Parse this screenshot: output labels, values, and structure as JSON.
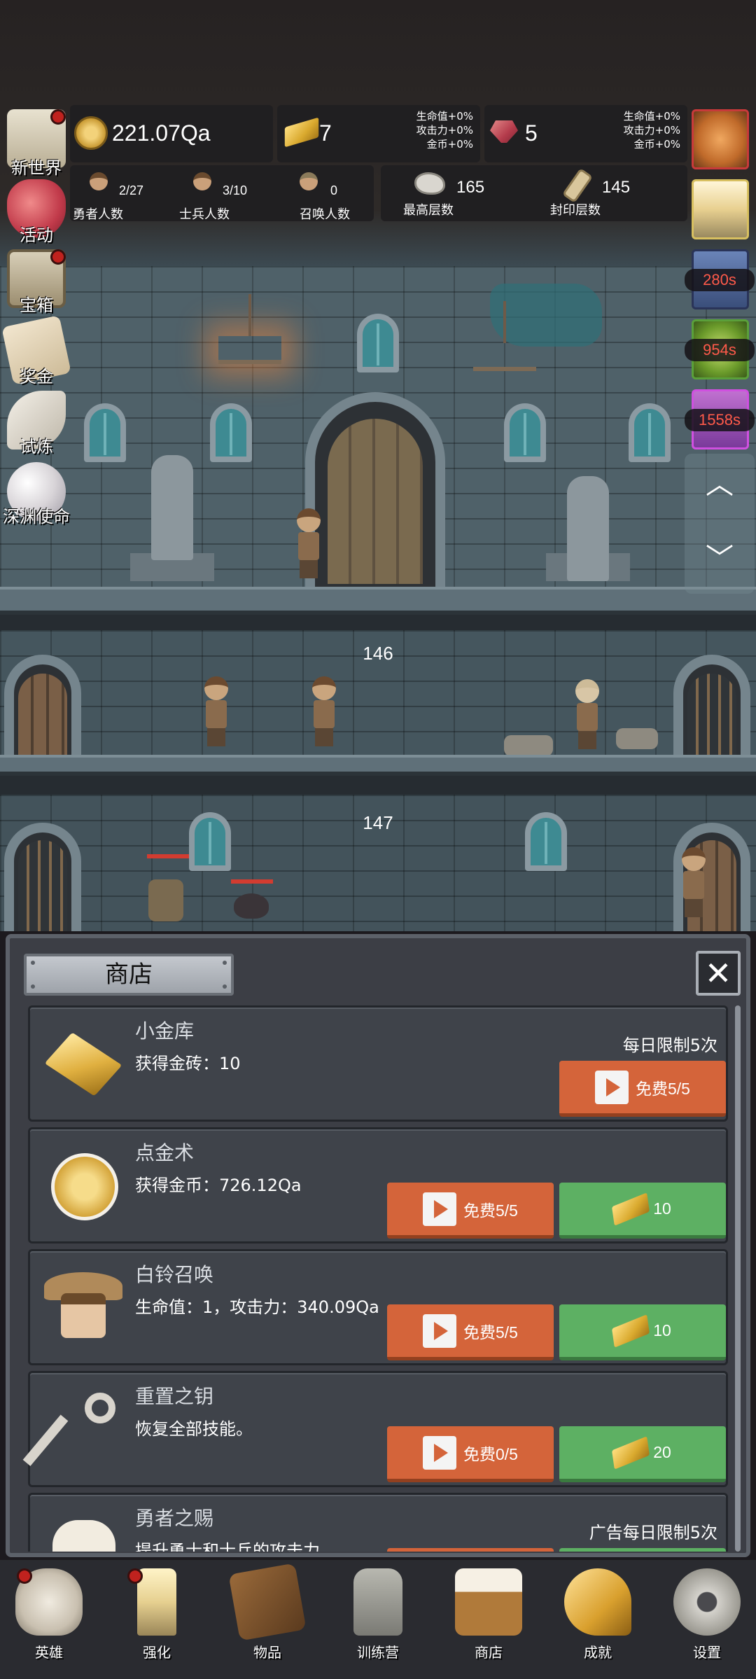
{
  "resources": {
    "gold": "221.07Qa",
    "gold_bars": "7",
    "bar_bonus": [
      "生命值+0%",
      "攻击力+0%",
      "金币+0%"
    ],
    "gems": "5",
    "gem_bonus": [
      "生命值+0%",
      "攻击力+0%",
      "金币+0%"
    ]
  },
  "counts": {
    "heroes": {
      "value": "2/27",
      "label": "勇者人数"
    },
    "soldiers": {
      "value": "3/10",
      "label": "士兵人数"
    },
    "summons": {
      "value": "0",
      "label": "召唤人数"
    },
    "max_floor": {
      "value": "165",
      "label": "最高层数"
    },
    "sealed_floor": {
      "value": "145",
      "label": "封印层数"
    }
  },
  "side_menu": [
    {
      "label": "新世界",
      "icon": "castle-icon"
    },
    {
      "label": "活动",
      "icon": "heart-icon"
    },
    {
      "label": "宝箱",
      "icon": "treasure-chest-icon"
    },
    {
      "label": "奖金",
      "icon": "envelope-icon"
    },
    {
      "label": "试炼",
      "icon": "feather-icon"
    },
    {
      "label": "深渊使命",
      "icon": "pearl-icon"
    }
  ],
  "buffs": [
    {
      "icon": "pumpkin-icon",
      "timer": ""
    },
    {
      "icon": "candle-icon",
      "timer": ""
    },
    {
      "icon": "blue-buff-icon",
      "timer": "280s"
    },
    {
      "icon": "green-buff-icon",
      "timer": "954s"
    },
    {
      "icon": "purple-buff-icon",
      "timer": "1558s"
    }
  ],
  "floors": [
    "146",
    "147"
  ],
  "shop": {
    "title": "商店",
    "close": "✕",
    "items": [
      {
        "name": "小金库",
        "desc": "获得金砖：10",
        "limit": "每日限制5次",
        "free": "免费5/5",
        "price": "",
        "icon": "gold-bar-icon"
      },
      {
        "name": "点金术",
        "desc": "获得金币：726.12Qa",
        "limit": "",
        "free": "免费5/5",
        "price": "10",
        "icon": "gold-coin-icon"
      },
      {
        "name": "白铃召唤",
        "desc": "生命值：1，攻击力：340.09Qa",
        "limit": "",
        "free": "免费5/5",
        "price": "10",
        "icon": "girl-portrait-icon"
      },
      {
        "name": "重置之钥",
        "desc": "恢复全部技能。",
        "limit": "",
        "free": "免费0/5",
        "price": "20",
        "icon": "key-icon"
      },
      {
        "name": "勇者之赐",
        "desc": "提升勇士和士兵的攻击力。",
        "limit": "广告每日限制5次",
        "free": "",
        "price": "",
        "icon": "beer-mug-icon"
      }
    ]
  },
  "nav": [
    {
      "label": "英雄",
      "icon": "skull-icon",
      "dot": true
    },
    {
      "label": "强化",
      "icon": "candle-icon",
      "dot": true
    },
    {
      "label": "物品",
      "icon": "book-icon",
      "dot": false
    },
    {
      "label": "训练营",
      "icon": "lantern-icon",
      "dot": false
    },
    {
      "label": "商店",
      "icon": "beer-mug-icon",
      "dot": false
    },
    {
      "label": "成就",
      "icon": "key-icon",
      "dot": false
    },
    {
      "label": "设置",
      "icon": "gear-icon",
      "dot": false
    }
  ],
  "colors": {
    "orange_button": "#d4643a",
    "green_button": "#5db063",
    "timer_red": "#ff5a4a",
    "alert_dot": "#c0221e"
  }
}
